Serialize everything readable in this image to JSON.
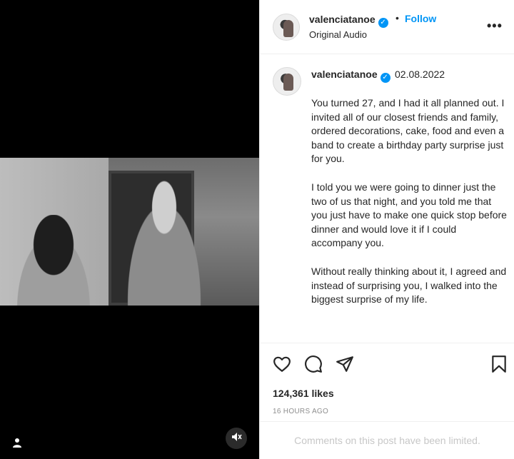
{
  "header": {
    "username": "valenciatanoe",
    "verified_glyph": "✓",
    "separator": "•",
    "follow_label": "Follow",
    "audio_label": "Original Audio",
    "more_glyph": "•••"
  },
  "post": {
    "username": "valenciatanoe",
    "verified_glyph": "✓",
    "date": "02.08.2022",
    "caption_paragraphs": [
      "You turned 27, and I had it all planned out. I invited all of our closest friends and family, ordered decorations, cake, food and even a band to create a birthday party surprise just for you.",
      "I told you we were going to dinner just the two of us that night, and you told me that you just have to make one quick stop before dinner and would love it if I could accompany you.",
      "Without really thinking about it, I agreed and instead of surprising you, I walked into the biggest surprise of my life."
    ]
  },
  "engagement": {
    "likes": "124,361 likes",
    "time_ago": "16 HOURS AGO"
  },
  "comments": {
    "limited_notice": "Comments on this post have been limited."
  },
  "icons": {
    "like": "heart-icon",
    "comment": "comment-icon",
    "share": "share-icon",
    "save": "bookmark-icon",
    "user_tag": "user-tag-icon",
    "mute": "muted-audio-icon"
  },
  "colors": {
    "accent": "#0095f6",
    "text": "#262626",
    "muted": "#8e8e8e",
    "media_bg": "#000000"
  }
}
